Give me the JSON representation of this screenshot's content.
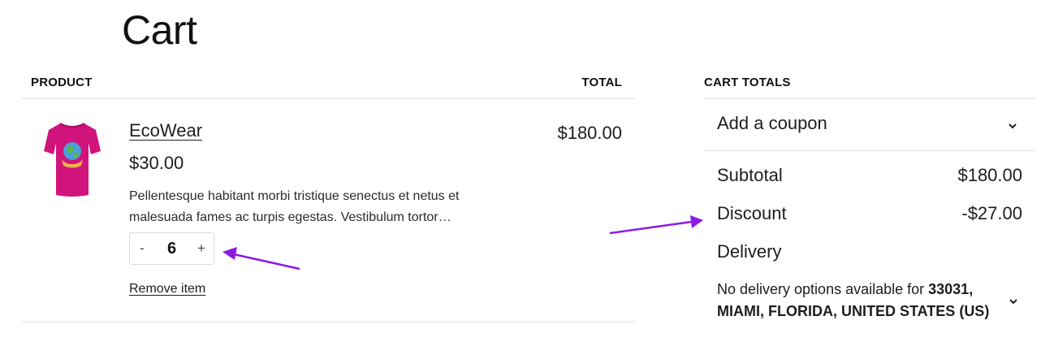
{
  "page": {
    "title": "Cart"
  },
  "cart_table": {
    "product_header": "PRODUCT",
    "total_header": "TOTAL",
    "item": {
      "name": "EcoWear",
      "price": "$30.00",
      "description": "Pellentesque habitant morbi tristique senectus et netus et malesuada fames ac turpis egestas. Vestibulum tortor…",
      "quantity": "6",
      "minus_label": "-",
      "plus_label": "+",
      "remove_label": "Remove item",
      "line_total": "$180.00",
      "image_icon": "tshirt-icon",
      "shirt_color": "#d1137c"
    }
  },
  "totals": {
    "header": "CART TOTALS",
    "coupon_label": "Add a coupon",
    "subtotal_label": "Subtotal",
    "subtotal_value": "$180.00",
    "discount_label": "Discount",
    "discount_value": "-$27.00",
    "delivery_label": "Delivery",
    "delivery_note_prefix": "No delivery options available for ",
    "delivery_note_location": "33031, MIAMI, FLORIDA, UNITED STATES (US)"
  },
  "annotations": {
    "arrow_color": "#8b1ae6"
  }
}
